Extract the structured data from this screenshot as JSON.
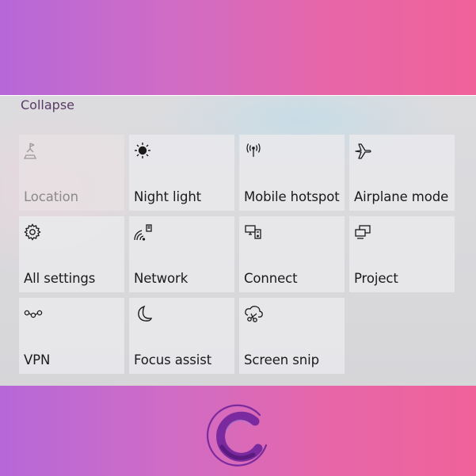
{
  "panel": {
    "collapse_label": "Collapse"
  },
  "tiles": [
    {
      "label": "Location",
      "icon": "location-icon",
      "disabled": true
    },
    {
      "label": "Night light",
      "icon": "night-light-icon"
    },
    {
      "label": "Mobile hotspot",
      "icon": "mobile-hotspot-icon"
    },
    {
      "label": "Airplane mode",
      "icon": "airplane-icon"
    },
    {
      "label": "All settings",
      "icon": "gear-icon"
    },
    {
      "label": "Network",
      "icon": "network-icon"
    },
    {
      "label": "Connect",
      "icon": "connect-icon"
    },
    {
      "label": "Project",
      "icon": "project-icon"
    },
    {
      "label": "VPN",
      "icon": "vpn-icon"
    },
    {
      "label": "Focus assist",
      "icon": "moon-icon"
    },
    {
      "label": "Screen snip",
      "icon": "screen-snip-icon"
    }
  ],
  "colors": {
    "gradient_start": "#b668d8",
    "gradient_end": "#f0629a",
    "tile_background": "#e9e9ec",
    "logo_purple": "#7a2a9e"
  },
  "logo": {
    "icon": "brand-logo-c-icon"
  }
}
